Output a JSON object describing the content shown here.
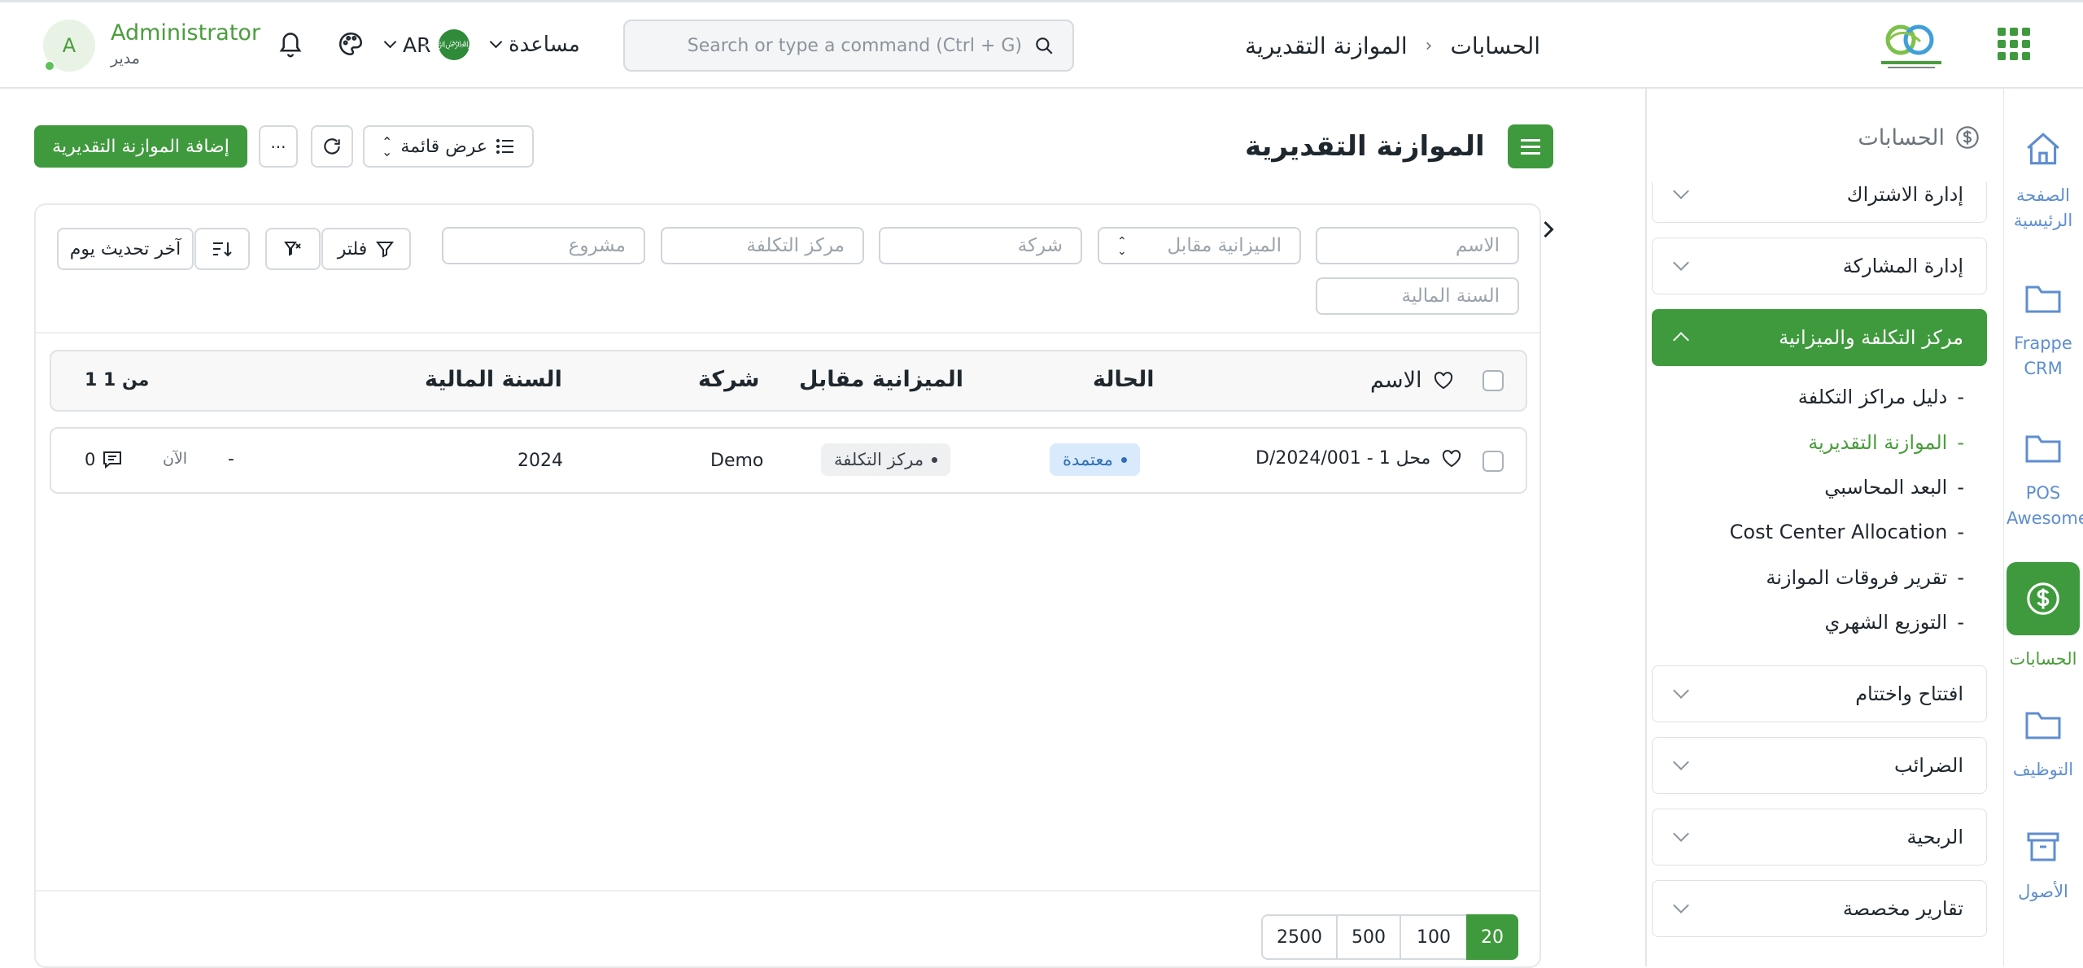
{
  "topbar": {
    "user_name": "Administrator",
    "user_role": "مدير",
    "avatar_letter": "A",
    "language": "AR",
    "help_label": "مساعدة",
    "search_placeholder": "Search or type a command (Ctrl + G)",
    "breadcrumb_root": "الحسابات",
    "breadcrumb_separator": "›",
    "breadcrumb_current": "الموازنة التقديرية"
  },
  "rail": {
    "items": [
      {
        "label": "الصفحة الرئيسية",
        "icon": "home-icon"
      },
      {
        "label": "Frappe CRM",
        "icon": "folder-icon"
      },
      {
        "label": "POS Awesome",
        "icon": "folder-icon"
      },
      {
        "label": "الحسابات",
        "icon": "dollar-icon"
      },
      {
        "label": "التوظيف",
        "icon": "folder-icon"
      },
      {
        "label": "الأصول",
        "icon": "archive-icon"
      }
    ]
  },
  "sidebar": {
    "title": "الحسابات",
    "sections": [
      {
        "label": "إدارة الاشتراك"
      },
      {
        "label": "إدارة المشاركة"
      },
      {
        "label": "مركز التكلفة والميزانية"
      },
      {
        "label": "افتتاح واختتام"
      },
      {
        "label": "الضرائب"
      },
      {
        "label": "الربحية"
      },
      {
        "label": "تقارير مخصصة"
      }
    ],
    "subitems": [
      {
        "label": "دليل مراكز التكلفة"
      },
      {
        "label": "الموازنة التقديرية"
      },
      {
        "label": "البعد المحاسبي"
      },
      {
        "label": "Cost Center Allocation"
      },
      {
        "label": "تقرير فروقات الموازنة"
      },
      {
        "label": "التوزيع الشهري"
      }
    ],
    "bullet": "-"
  },
  "page": {
    "title": "الموازنة التقديرية",
    "view_label": "عرض قائمة",
    "add_label": "إضافة الموازنة التقديرية",
    "more_label": "..."
  },
  "filters": {
    "name_placeholder": "الاسم",
    "budget_against_placeholder": "الميزانية مقابل",
    "company_placeholder": "شركة",
    "cost_center_placeholder": "مركز التكلفة",
    "project_placeholder": "مشروع",
    "fiscal_year_placeholder": "السنة المالية",
    "filter_label": "فلتر",
    "sort_label": "آخر تحديث يوم"
  },
  "table": {
    "headers": {
      "name": "الاسم",
      "status": "الحالة",
      "budget_against": "الميزانية مقابل",
      "company": "شركة",
      "fiscal_year": "السنة المالية",
      "count": "1 من 1"
    },
    "rows": [
      {
        "name": "محل 1 - D/2024/001",
        "status": "معتمدة",
        "budget_against": "مركز التكلفة",
        "company": "Demo",
        "fiscal_year": "2024",
        "dash": "-",
        "modified": "الآن",
        "comments": "0"
      }
    ]
  },
  "paging": [
    "20",
    "100",
    "500",
    "2500"
  ],
  "colors": {
    "primary": "#3f9a3d",
    "link": "#5e8ed0",
    "status_bg": "#d9eafc",
    "status_text": "#2f6fb5"
  }
}
